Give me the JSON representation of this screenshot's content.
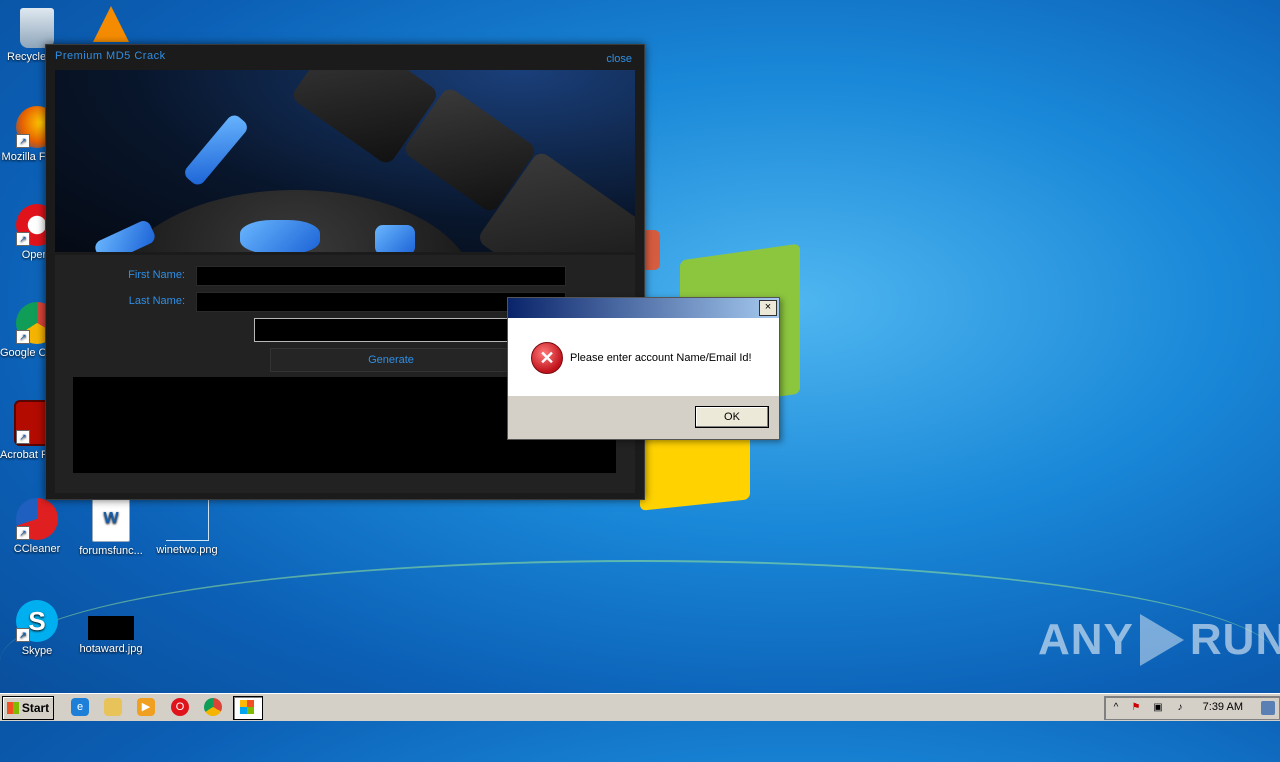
{
  "desktop": {
    "icons": [
      {
        "label": "Recycle Bin",
        "icon": "recycle-bin-icon"
      },
      {
        "label": "VLC media player",
        "icon": "vlc-icon"
      },
      {
        "label": "Mozilla Firefox",
        "icon": "firefox-icon"
      },
      {
        "label": "Opera",
        "icon": "opera-icon"
      },
      {
        "label": "Google Chrome",
        "icon": "chrome-icon"
      },
      {
        "label": "Acrobat Reader DC",
        "icon": "acrobat-icon"
      },
      {
        "label": "CCleaner",
        "icon": "ccleaner-icon"
      },
      {
        "label": "forumsfunc...",
        "icon": "word-doc-icon"
      },
      {
        "label": "winetwo.png",
        "icon": "image-file-icon"
      },
      {
        "label": "Skype",
        "icon": "skype-icon"
      },
      {
        "label": "hotaward.jpg",
        "icon": "image-file-icon"
      }
    ]
  },
  "crack_window": {
    "title": "Premium MD5  Crack",
    "close_label": "close",
    "first_name_label": "First Name:",
    "last_name_label": "Last Name:",
    "first_name_value": "",
    "last_name_value": "",
    "serial_value": "",
    "generate_label": "Generate",
    "output_text": ""
  },
  "error_dialog": {
    "title": "",
    "close_glyph": "×",
    "message": "Please enter account Name/Email Id!",
    "icon_glyph": "✕",
    "ok_label": "OK"
  },
  "watermark": {
    "left": "ANY",
    "right": "RUN"
  },
  "taskbar": {
    "start_label": "Start",
    "clock": "7:39 AM",
    "pinned": [
      "ie-icon",
      "explorer-icon",
      "media-player-icon",
      "opera-icon",
      "chrome-icon",
      "crack-app-icon"
    ],
    "tray_expand": "^"
  },
  "colors": {
    "accent_blue": "#2e8fe6",
    "dialog_title_start": "#0a246a",
    "error_red": "#c0121b"
  }
}
